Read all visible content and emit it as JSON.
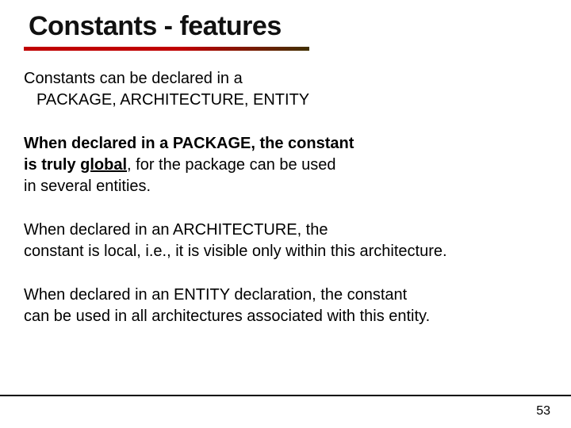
{
  "title": "Constants - features",
  "p1_l1": "Constants can be declared in a",
  "p1_l2": "PACKAGE, ARCHITECTURE, ENTITY",
  "p2_l1a": "When declared in a PACKAGE, the constant",
  "p2_l2a": "is truly ",
  "p2_l2b": "global",
  "p2_l2c": ", for the package can be used",
  "p2_l3": "in several entities.",
  "p3_l1": "When declared in an ARCHITECTURE, the",
  "p3_l2": "constant is local, i.e., it is visible only within this architecture.",
  "p4_l1": "When declared in an ENTITY declaration, the constant",
  "p4_l2": "can be used in all architectures associated with this entity.",
  "page": "53"
}
